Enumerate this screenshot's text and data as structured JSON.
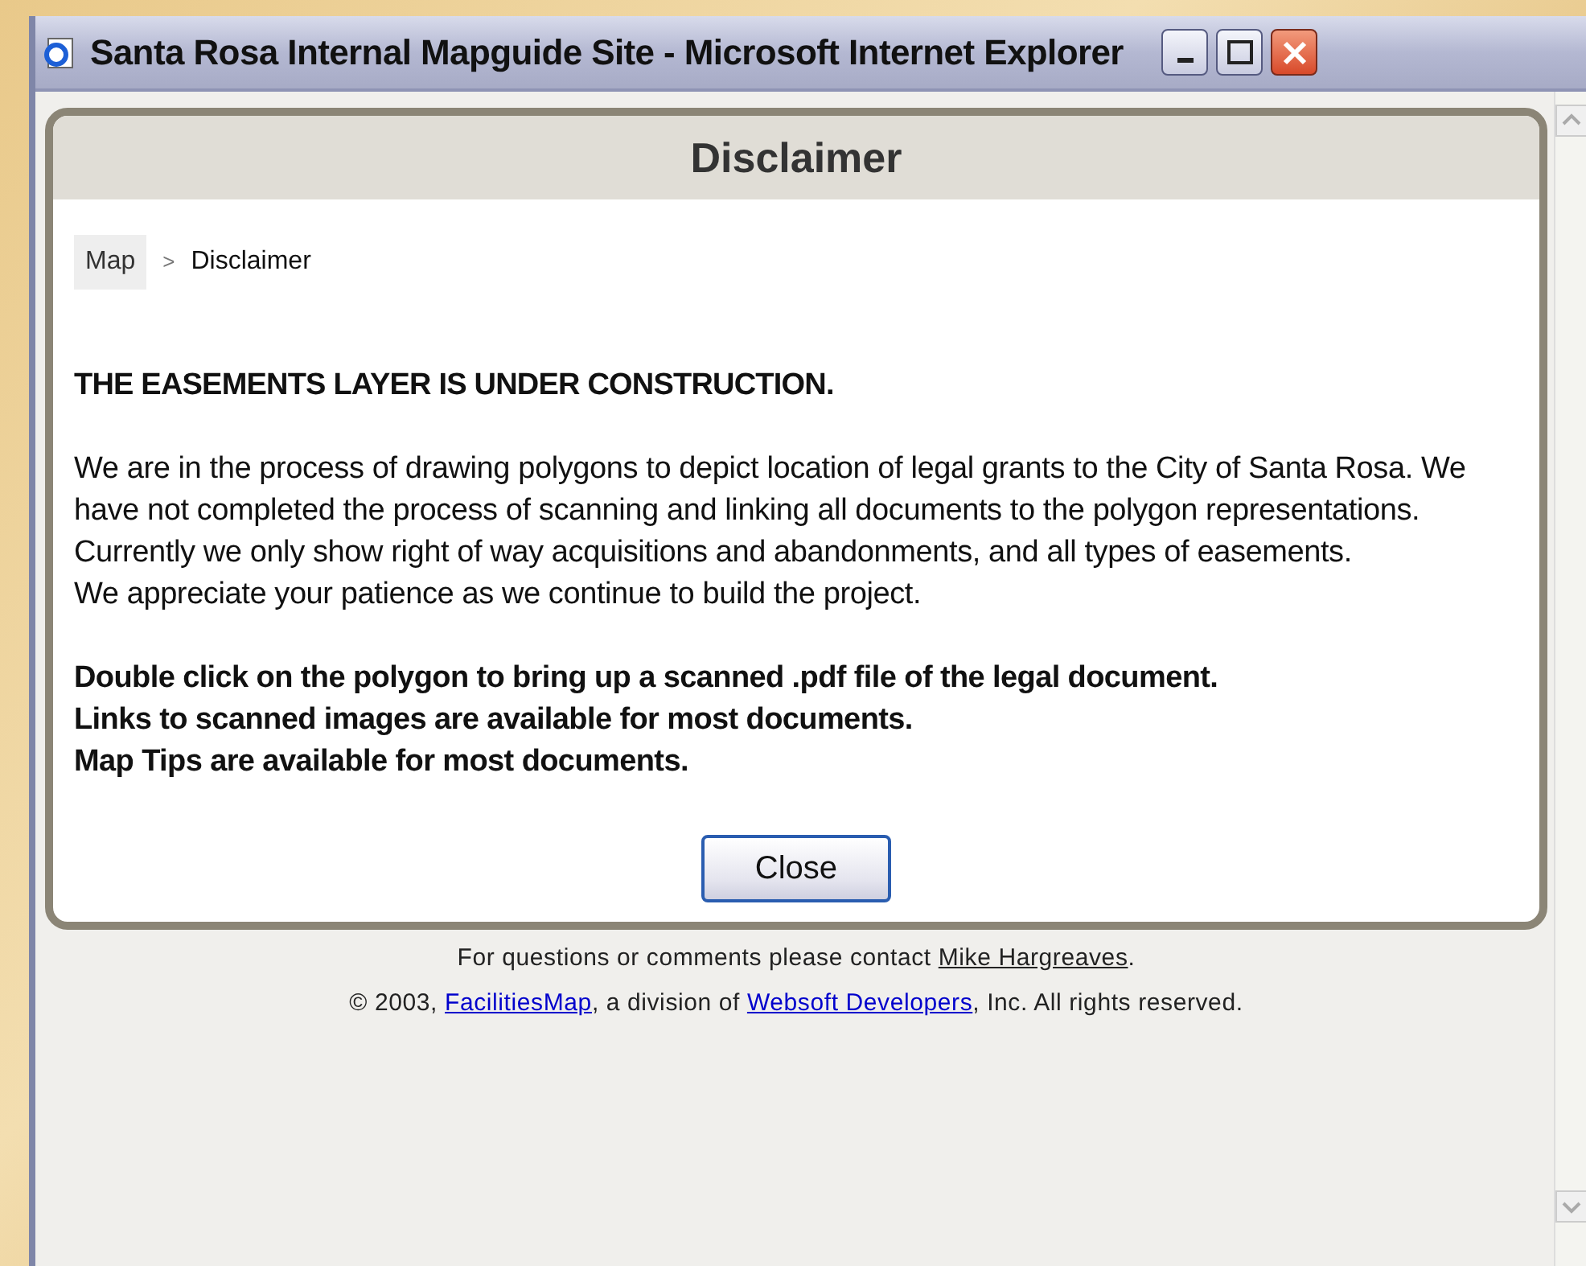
{
  "window": {
    "title": "Santa Rosa Internal Mapguide Site - Microsoft Internet Explorer"
  },
  "dialog": {
    "title": "Disclaimer",
    "breadcrumb": [
      {
        "label": "Map",
        "kind": "link"
      },
      {
        "label": ">",
        "kind": "separator"
      },
      {
        "label": "Disclaimer",
        "kind": "current"
      }
    ],
    "heading": "THE EASEMENTS LAYER IS UNDER CONSTRUCTION.",
    "paragraph_lines": [
      "We are in the process of drawing polygons to depict location of legal grants to the City of Santa Rosa. We have not completed the process of scanning and linking all documents to the polygon representations. Currently we only show right of way acquisitions and abandonments, and all types of easements.",
      "We appreciate your patience as we continue to build the project."
    ],
    "notes": [
      "Double click on the polygon to bring up a scanned .pdf file of the legal document.",
      "Links to scanned images are available for most documents.",
      "Map Tips are available for most documents."
    ],
    "close_button": "Close"
  },
  "footer": {
    "contact_text": "For questions or comments please contact",
    "contact_link": "Mike Hargreaves",
    "contact_end": ".",
    "copyright": "© 2003,",
    "link1": "FacilitiesMap",
    "middle": ", a division of",
    "link2": "Websoft Developers",
    "end": ", Inc. All rights reserved."
  }
}
